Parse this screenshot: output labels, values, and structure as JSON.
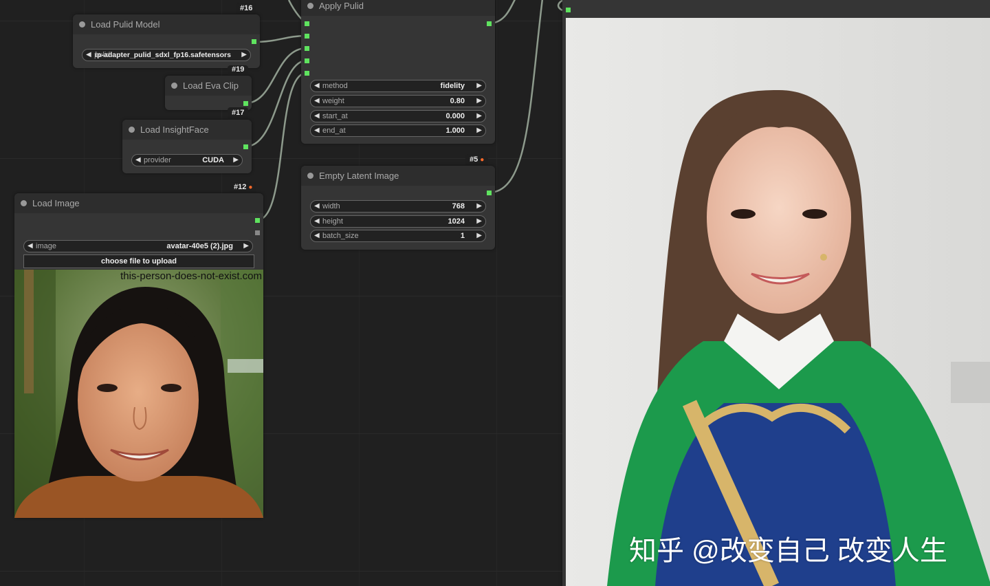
{
  "nodes": {
    "load_pulid_model": {
      "title": "Load Pulid Model",
      "badge": "#16",
      "widget": {
        "label": "pulid",
        "value": "ip-adapter_pulid_sdxl_fp16.safetensors"
      }
    },
    "load_eva_clip": {
      "title": "Load Eva Clip",
      "badge": "#17",
      "badge_top": "#19"
    },
    "load_insightface": {
      "title": "Load InsightFace",
      "widget": {
        "label": "provider",
        "value": "CUDA"
      }
    },
    "load_image": {
      "title": "Load Image",
      "badge": "#12",
      "widget": {
        "label": "image",
        "value": "avatar-40e5 (2).jpg"
      },
      "upload_label": "choose file to upload",
      "image_watermark": "this-person-does-not-exist.com"
    },
    "apply_pulid": {
      "title": "Apply Pulid",
      "widgets": [
        {
          "label": "method",
          "value": "fidelity"
        },
        {
          "label": "weight",
          "value": "0.80"
        },
        {
          "label": "start_at",
          "value": "0.000"
        },
        {
          "label": "end_at",
          "value": "1.000"
        }
      ]
    },
    "empty_latent": {
      "title": "Empty Latent Image",
      "badge": "#5",
      "widgets": [
        {
          "label": "width",
          "value": "768"
        },
        {
          "label": "height",
          "value": "1024"
        },
        {
          "label": "batch_size",
          "value": "1"
        }
      ]
    }
  },
  "preview": {
    "watermark": "知乎 @改变自己 改变人生"
  },
  "colors": {
    "slot": "#5fe35f",
    "link": "#a8bba8",
    "canvas": "#202020",
    "node": "#353535"
  },
  "icons": {
    "badge_icon": "fox-icon",
    "widget_left": "triangle-left-icon",
    "widget_right": "triangle-right-icon"
  }
}
